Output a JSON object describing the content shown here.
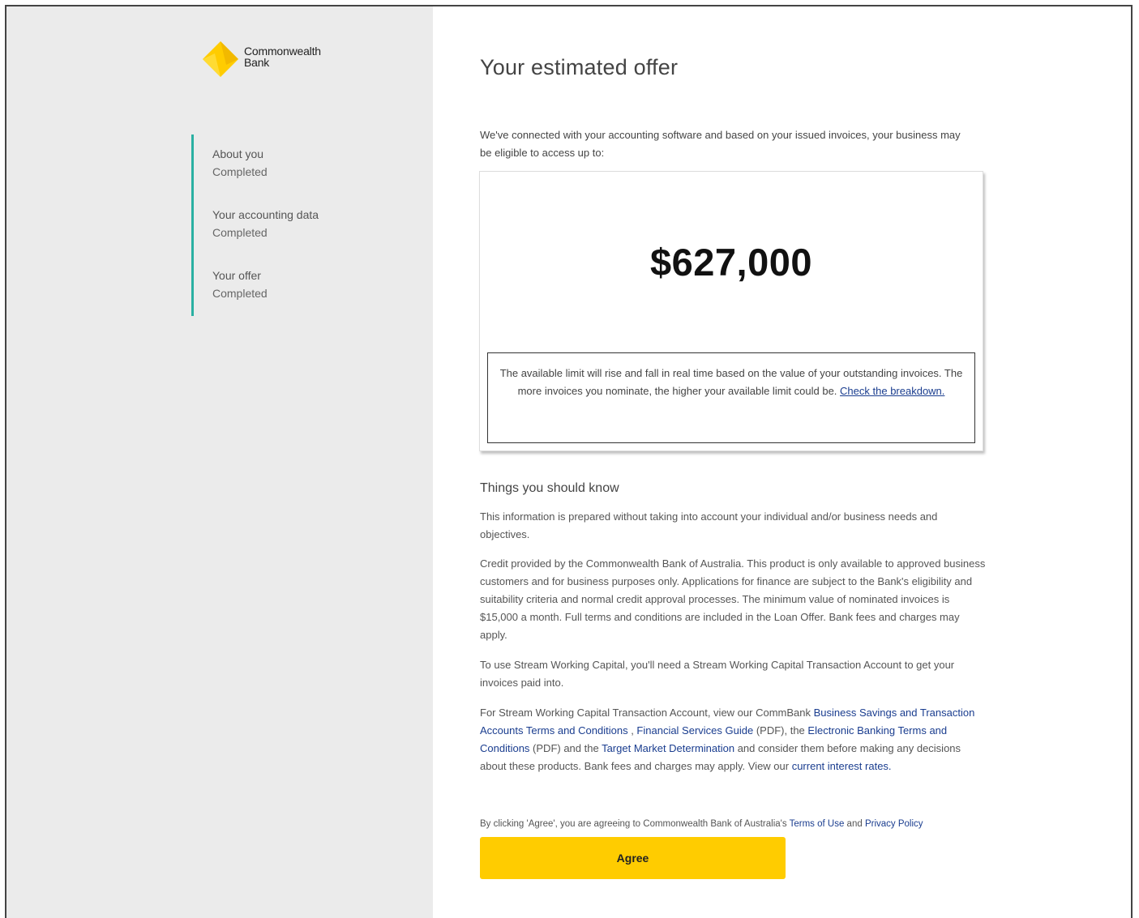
{
  "brand": {
    "name_line1": "Commonwealth",
    "name_line2": "Bank",
    "logo_icon": "cba-diamond-icon",
    "accent_color": "#ffcc00",
    "progress_color": "#2ab0a2"
  },
  "steps": [
    {
      "title": "About you",
      "status": "Completed"
    },
    {
      "title": "Your accounting data",
      "status": "Completed"
    },
    {
      "title": "Your offer",
      "status": "Completed"
    }
  ],
  "main": {
    "title": "Your estimated offer",
    "intro": "We've connected with your accounting software and based on your issued invoices, your business may be eligible to access up to:",
    "offer_amount": "$627,000",
    "limit_note": "The available limit will rise and fall in real time based on the value of your outstanding invoices. The more invoices you nominate, the higher your available limit could be.",
    "limit_link": "Check the breakdown."
  },
  "things": {
    "heading": "Things you should know",
    "para1": "This information is prepared without taking into account your individual and/or business needs and objectives.",
    "para2": "Credit provided by the Commonwealth Bank of Australia. This product is only available to approved business customers and for business purposes only. Applications for finance are subject to the Bank's eligibility and suitability criteria and normal credit approval processes. The minimum value of nominated invoices is $15,000 a month. Full terms and conditions are included in the Loan Offer. Bank fees and charges may apply.",
    "para3": "To use Stream Working Capital, you'll need a Stream Working Capital Transaction Account to get your invoices paid into.",
    "para4": {
      "t1": "For Stream Working Capital Transaction Account, view our CommBank ",
      "link1": "Business Savings and Transaction Accounts Terms and Conditions",
      "t2": " , ",
      "link2": "Financial Services Guide",
      "t3": " (PDF), the ",
      "link3": "Electronic Banking Terms and Conditions",
      "t4": " (PDF) and the ",
      "link4": "Target Market Determination",
      "t5": " and consider them before making any decisions about these products. Bank fees and charges may apply. View our ",
      "link5": "current interest rates."
    }
  },
  "consent": {
    "t1": "By clicking 'Agree', you are agreeing to Commonwealth Bank of Australia's ",
    "terms_link": "Terms of Use",
    "t2": " and ",
    "privacy_link": "Privacy Policy"
  },
  "agree_label": "Agree"
}
